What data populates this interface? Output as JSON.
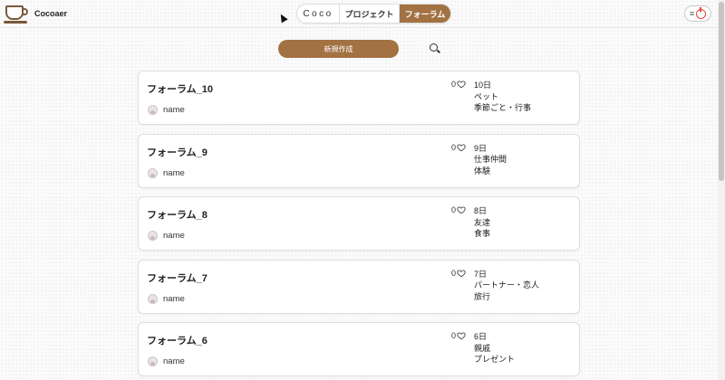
{
  "header": {
    "logo_text": "Cocoaer",
    "tabs": [
      {
        "label": "Coco"
      },
      {
        "label": "プロジェクト"
      },
      {
        "label": "フォーラム"
      }
    ],
    "menu_icon": "hamburger-icon",
    "power_icon": "power-icon"
  },
  "toolbar": {
    "new_button_label": "新規作成",
    "search_icon": "search-icon"
  },
  "posts": [
    {
      "title": "フォーラム_10",
      "author": "name",
      "likes": "0",
      "date": "10日",
      "tag1": "ペット",
      "tag2": "季節ごと・行事"
    },
    {
      "title": "フォーラム_9",
      "author": "name",
      "likes": "0",
      "date": "9日",
      "tag1": "仕事仲間",
      "tag2": "体験"
    },
    {
      "title": "フォーラム_8",
      "author": "name",
      "likes": "0",
      "date": "8日",
      "tag1": "友達",
      "tag2": "食事"
    },
    {
      "title": "フォーラム_7",
      "author": "name",
      "likes": "0",
      "date": "7日",
      "tag1": "パートナー・恋人",
      "tag2": "旅行"
    },
    {
      "title": "フォーラム_6",
      "author": "name",
      "likes": "0",
      "date": "6日",
      "tag1": "親戚",
      "tag2": "プレゼント"
    }
  ],
  "colors": {
    "accent": "#a27243",
    "power": "#e0473a"
  }
}
